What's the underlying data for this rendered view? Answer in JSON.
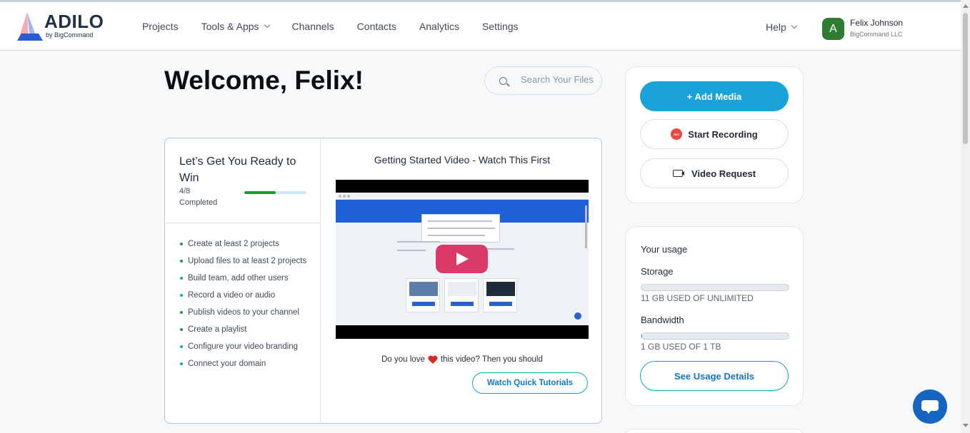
{
  "logo": {
    "word": "ADILO",
    "sub": "by BigCommand"
  },
  "nav": {
    "items": [
      {
        "label": "Projects",
        "dropdown": false
      },
      {
        "label": "Tools & Apps",
        "dropdown": true
      },
      {
        "label": "Channels",
        "dropdown": false
      },
      {
        "label": "Contacts",
        "dropdown": false
      },
      {
        "label": "Analytics",
        "dropdown": false
      },
      {
        "label": "Settings",
        "dropdown": false
      }
    ],
    "help": "Help"
  },
  "user": {
    "initial": "A",
    "name": "Felix Johnson",
    "org": "BigCommand LLC",
    "avatar_color": "#2f7d32"
  },
  "welcome": "Welcome, Felix!",
  "search": {
    "placeholder": "Search Your Files",
    "value": ""
  },
  "onboarding": {
    "title": "Let’s Get You Ready to Win",
    "count": "4/8",
    "completed_label": "Completed",
    "progress_fraction": 0.5,
    "tasks": [
      {
        "label": "Create at least 2 projects",
        "done": true
      },
      {
        "label": "Upload files to at least 2 projects",
        "done": true
      },
      {
        "label": "Build team, add other users",
        "done": false
      },
      {
        "label": "Record a video or audio",
        "done": false
      },
      {
        "label": "Publish videos to your channel",
        "done": true
      },
      {
        "label": "Create a playlist",
        "done": true
      },
      {
        "label": "Configure your video branding",
        "done": false
      },
      {
        "label": "Connect your domain",
        "done": false
      }
    ]
  },
  "video": {
    "title": "Getting Started Video - Watch This First",
    "love_prefix": "Do you love",
    "love_suffix": "this video? Then you should",
    "tutorials_button": "Watch Quick Tutorials"
  },
  "actions": {
    "add_media": "+ Add Media",
    "start_recording": "Start Recording",
    "rec_badge": "REC",
    "video_request": "Video Request"
  },
  "usage": {
    "title": "Your usage",
    "storage_label": "Storage",
    "storage_text": "11 GB USED OF UNLIMITED",
    "storage_fraction": 0.0,
    "bandwidth_label": "Bandwidth",
    "bandwidth_text": "1 GB USED OF 1 TB",
    "bandwidth_fraction": 0.001,
    "details_button": "See Usage Details"
  },
  "colors": {
    "accent": "#19a3d8",
    "success": "#1f9a3a",
    "play": "#d93a68"
  }
}
